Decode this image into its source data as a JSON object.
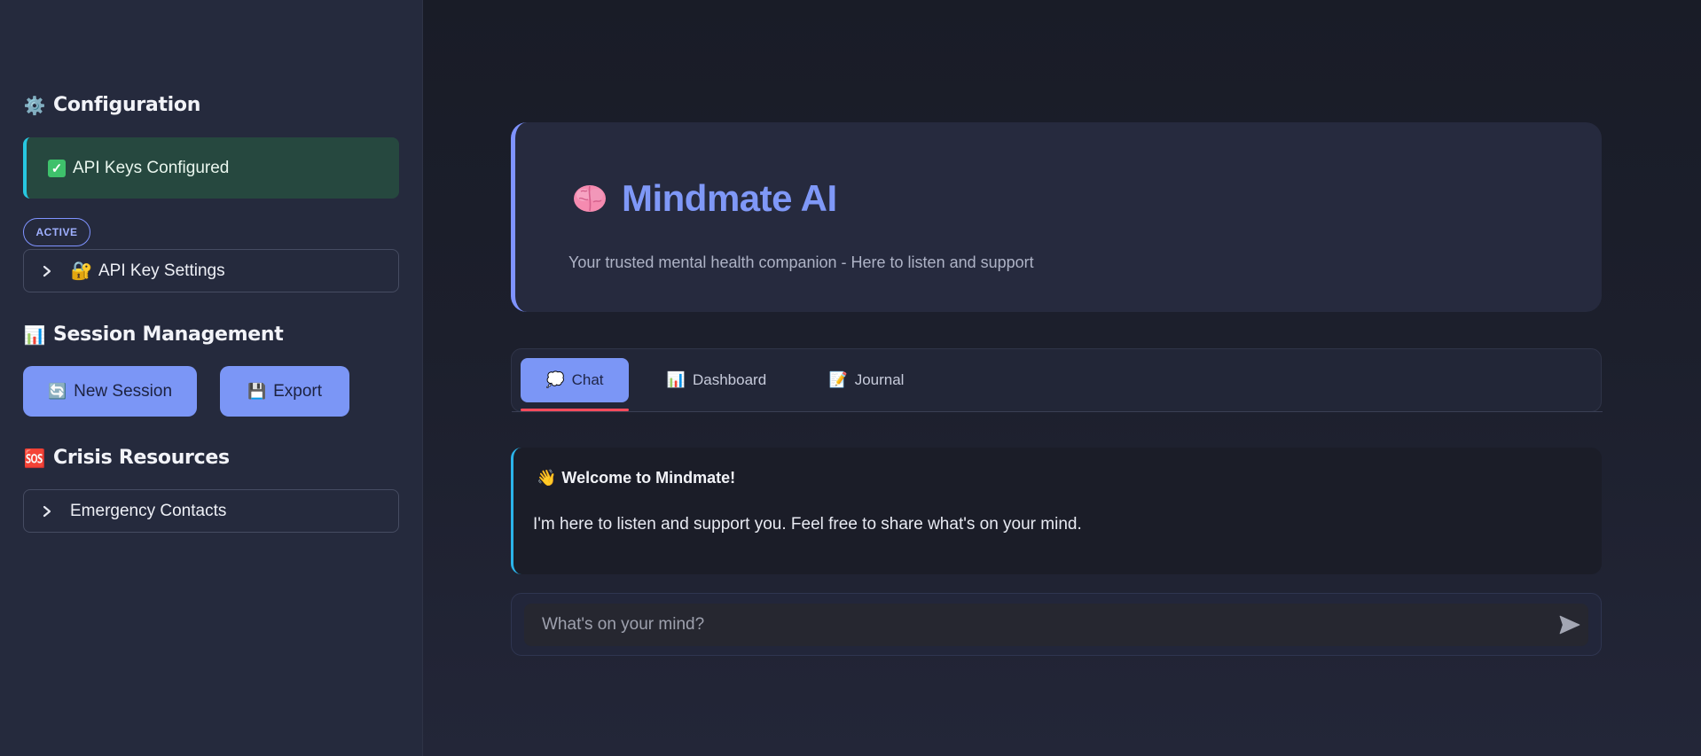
{
  "sidebar": {
    "configuration": {
      "icon": "gear-icon",
      "emoji": "⚙️",
      "title": "Configuration"
    },
    "api_status": {
      "icon": "check-icon",
      "label": "API Keys Configured"
    },
    "badge": "ACTIVE",
    "api_settings": {
      "icon": "lock-key-icon",
      "emoji": "🔐",
      "label": "API Key Settings"
    },
    "session": {
      "icon": "bar-chart-icon",
      "emoji": "📊",
      "title": "Session Management",
      "new_session": {
        "icon": "refresh-icon",
        "emoji": "🔄",
        "label": "New Session"
      },
      "export": {
        "icon": "floppy-icon",
        "emoji": "💾",
        "label": "Export"
      }
    },
    "crisis": {
      "icon": "sos-icon",
      "emoji": "🆘",
      "title": "Crisis Resources",
      "emergency": {
        "label": "Emergency Contacts"
      }
    }
  },
  "header": {
    "icon": "brain-icon",
    "title": "Mindmate AI",
    "subtitle": "Your trusted mental health companion - Here to listen and support"
  },
  "tabs": [
    {
      "icon": "speech-bubble-icon",
      "emoji": "💭",
      "label": "Chat",
      "active": true
    },
    {
      "icon": "bar-chart-icon",
      "emoji": "📊",
      "label": "Dashboard",
      "active": false
    },
    {
      "icon": "notebook-icon",
      "emoji": "📝",
      "label": "Journal",
      "active": false
    }
  ],
  "welcome": {
    "icon": "waving-hand-icon",
    "emoji": "👋",
    "title": "Welcome to Mindmate!",
    "body": "I'm here to listen and support you. Feel free to share what's on your mind."
  },
  "chat_input": {
    "placeholder": "What's on your mind?",
    "value": ""
  },
  "colors": {
    "accent": "#7b96f6",
    "sidebar_bg": "#252a3d",
    "main_bg": "#1b1e2b",
    "success_bg": "#26483f",
    "info_border": "#2bb4ea",
    "tab_underline": "#ff4b5c"
  }
}
